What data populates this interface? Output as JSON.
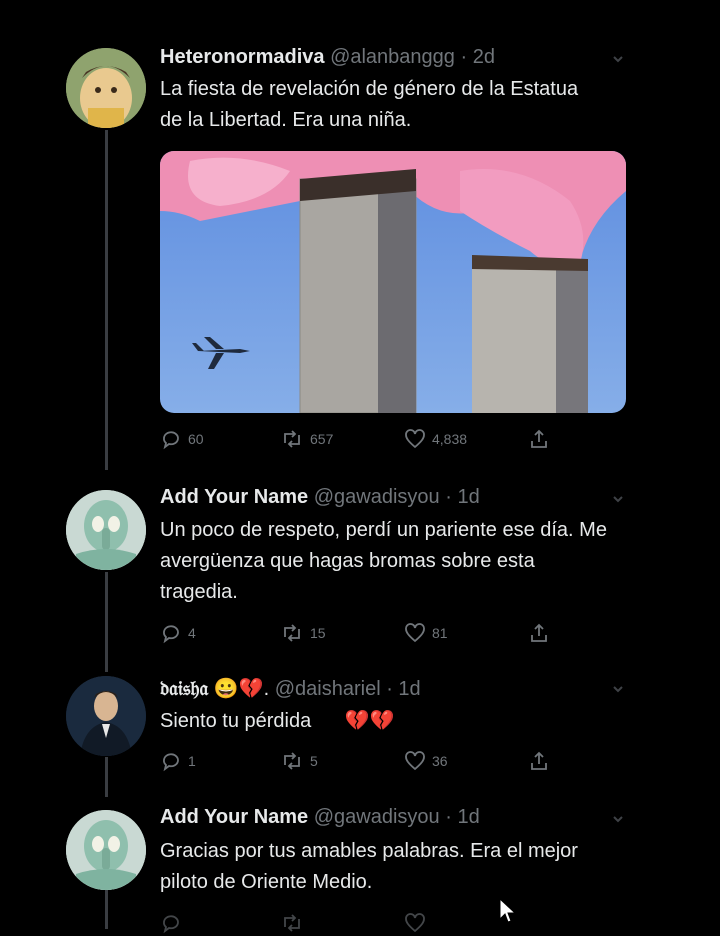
{
  "tweets": [
    {
      "name": "Heteronormadiva",
      "handle": "@alanbanggg",
      "time": "· 2d",
      "text": "La fiesta de revelación de género de la Estatua de la Libertad. Era una niña.",
      "replies": "60",
      "retweets": "657",
      "likes": "4,838",
      "avatar_icon": "cartoon-character-avatar"
    },
    {
      "name": "Add Your Name",
      "handle": "@gawadisyou",
      "time": "· 1d",
      "text": "Un poco de respeto, perdí un pariente ese día. Me avergüenza que hagas bromas sobre esta tragedia.",
      "replies": "4",
      "retweets": "15",
      "likes": "81",
      "avatar_icon": "squidward-avatar"
    },
    {
      "name": "𝔡𝔞𝔦𝔰𝔥𝔞",
      "name_emoji": "😀💔.",
      "handle": "@daishariel",
      "time": "· 1d",
      "text": "Siento tu pérdida",
      "text_emoji": "💔💔",
      "replies": "1",
      "retweets": "5",
      "likes": "36",
      "avatar_icon": "man-in-suit-avatar"
    },
    {
      "name": "Add Your Name",
      "handle": "@gawadisyou",
      "time": "· 1d",
      "text": "Gracias por tus amables palabras. Era el mejor piloto de Oriente Medio.",
      "avatar_icon": "squidward-avatar"
    }
  ],
  "colors": {
    "background": "#000000",
    "text": "#e7e9ea",
    "secondary": "#71767b",
    "thread_line": "#3a3d42",
    "smoke": "#ee8fb4",
    "sky": "#6f9ae0"
  }
}
